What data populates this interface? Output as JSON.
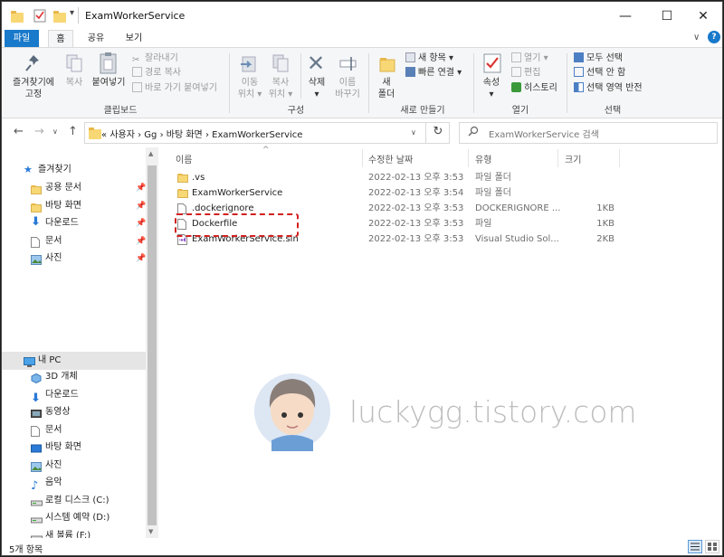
{
  "window": {
    "title": "ExamWorkerService",
    "controls": {
      "minimize": "—",
      "maximize": "☐",
      "close": "✕"
    },
    "qa_dropdown": "▾"
  },
  "ribbon_tabs": [
    {
      "label": "파일"
    },
    {
      "label": "홈"
    },
    {
      "label": "공유"
    },
    {
      "label": "보기"
    }
  ],
  "ribbon_right": {
    "chevron": "∨",
    "help": "?"
  },
  "ribbon": {
    "clipboard": {
      "pin_label": "즐겨찾기에\n고정",
      "copy_label": "복사",
      "paste_label": "붙여넣기",
      "cut_label": "잘라내기",
      "copy_path_label": "경로 복사",
      "paste_shortcut_label": "바로 가기 붙여넣기",
      "group_label": "클립보드"
    },
    "organize": {
      "move_label": "이동\n위치 ▾",
      "copyto_label": "복사\n위치 ▾",
      "delete_label": "삭제\n▾",
      "rename_label": "이름\n바꾸기",
      "group_label": "구성"
    },
    "new": {
      "new_folder_label": "새\n폴더",
      "new_item_label": "새 항목 ▾",
      "quick_access_label": "빠른 연결 ▾",
      "group_label": "새로 만들기"
    },
    "open": {
      "properties_label": "속성\n▾",
      "open_label": "열기 ▾",
      "edit_label": "편집",
      "history_label": "히스토리",
      "group_label": "열기"
    },
    "select": {
      "select_all_label": "모두 선택",
      "select_none_label": "선택 안 함",
      "invert_label": "선택 영역 반전",
      "group_label": "선택"
    }
  },
  "address": {
    "back": "←",
    "forward": "→",
    "recent": "∨",
    "up": "↑",
    "path_prefix": "«",
    "breadcrumb": [
      "사용자",
      "Gg",
      "바탕 화면",
      "ExamWorkerService"
    ],
    "separator": "›",
    "path_dropdown": "∨",
    "refresh": "↻",
    "search_placeholder": "ExamWorkerService 검색"
  },
  "nav": {
    "quick_access_label": "즐겨찾기",
    "quick_items": [
      "공용 문서",
      "바탕 화면",
      "다운로드",
      "문서",
      "사진"
    ],
    "pin_glyph": "📌",
    "this_pc_label": "내 PC",
    "pc_items": [
      "3D 개체",
      "다운로드",
      "동영상",
      "문서",
      "바탕 화면",
      "사진",
      "음악",
      "로컬 디스크 (C:)",
      "시스템 예약 (D:)",
      "새 볼륨 (F:)"
    ]
  },
  "columns": {
    "name": "이름",
    "date": "수정한 날짜",
    "type": "유형",
    "size": "크기",
    "sort_glyph": "^"
  },
  "files": [
    {
      "name": ".vs",
      "date": "2022-02-13 오후 3:53",
      "type": "파일 폴더",
      "size": "",
      "kind": "folder"
    },
    {
      "name": "ExamWorkerService",
      "date": "2022-02-13 오후 3:54",
      "type": "파일 폴더",
      "size": "",
      "kind": "folder"
    },
    {
      "name": ".dockerignore",
      "date": "2022-02-13 오후 3:53",
      "type": "DOCKERIGNORE ...",
      "size": "1KB",
      "kind": "file"
    },
    {
      "name": "Dockerfile",
      "date": "2022-02-13 오후 3:53",
      "type": "파일",
      "size": "1KB",
      "kind": "file"
    },
    {
      "name": "ExamWorkerService.sln",
      "date": "2022-02-13 오후 3:53",
      "type": "Visual Studio Sol...",
      "size": "2KB",
      "kind": "sln"
    }
  ],
  "watermark": "luckygg.tistory.com",
  "status": {
    "item_count": "5개 항목"
  },
  "colors": {
    "accent": "#1979ca",
    "folder": "#f8d775",
    "highlight": "#d21f1f"
  }
}
